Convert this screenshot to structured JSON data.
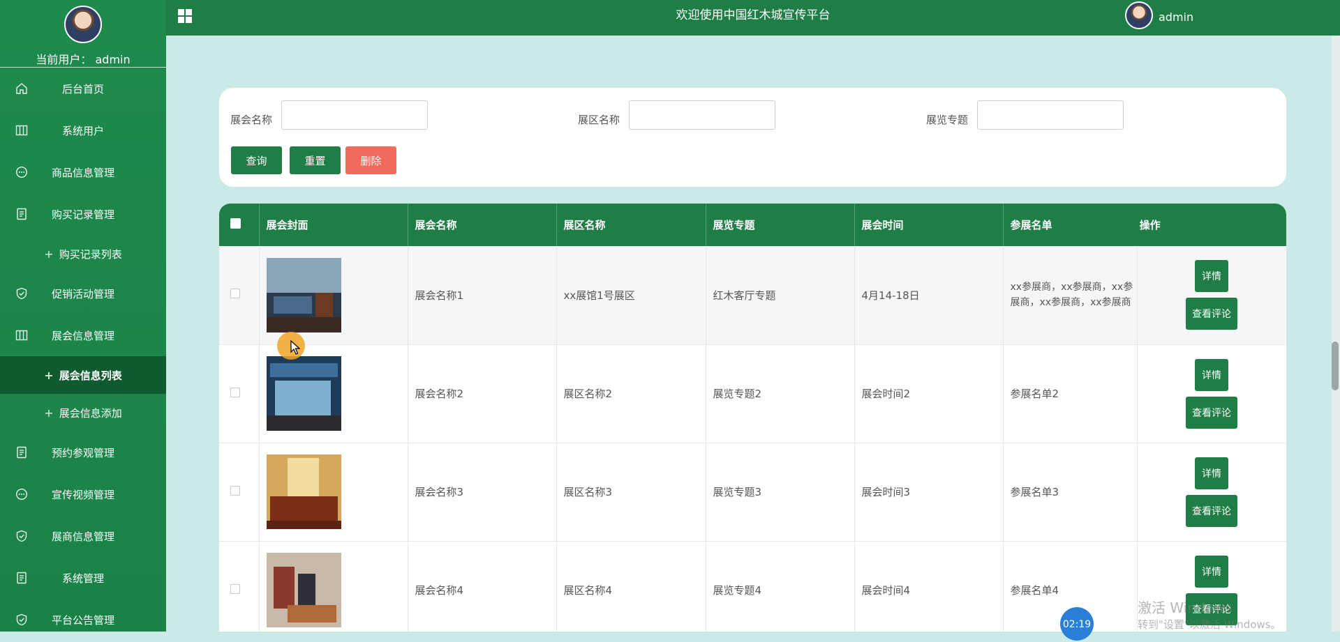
{
  "sidebar": {
    "user_label": "当前用户：",
    "username": "admin",
    "items": [
      {
        "label": "后台首页",
        "icon": "home-icon"
      },
      {
        "label": "系统用户",
        "icon": "columns-icon"
      },
      {
        "label": "商品信息管理",
        "icon": "chat-icon"
      },
      {
        "label": "购买记录管理",
        "icon": "document-icon",
        "children": [
          {
            "label": "购买记录列表"
          }
        ]
      },
      {
        "label": "促销活动管理",
        "icon": "shield-icon"
      },
      {
        "label": "展会信息管理",
        "icon": "columns-icon",
        "children": [
          {
            "label": "展会信息列表",
            "active": true
          },
          {
            "label": "展会信息添加"
          }
        ]
      },
      {
        "label": "预约参观管理",
        "icon": "document-icon"
      },
      {
        "label": "宣传视频管理",
        "icon": "chat-icon"
      },
      {
        "label": "展商信息管理",
        "icon": "shield-icon"
      },
      {
        "label": "系统管理",
        "icon": "document-icon"
      },
      {
        "label": "平台公告管理",
        "icon": "shield-icon"
      }
    ]
  },
  "header": {
    "title": "欢迎使用中国红木城宣传平台",
    "username": "admin"
  },
  "search": {
    "fields": [
      {
        "label": "展会名称",
        "value": ""
      },
      {
        "label": "展区名称",
        "value": ""
      },
      {
        "label": "展览专题",
        "value": ""
      }
    ],
    "query_label": "查询",
    "reset_label": "重置",
    "delete_label": "删除"
  },
  "table": {
    "columns": [
      "展会封面",
      "展会名称",
      "展区名称",
      "展览专题",
      "展会时间",
      "参展名单",
      "操作"
    ],
    "rows": [
      {
        "name": "展会名称1",
        "area": "xx展馆1号展区",
        "topic": "红木客厅专题",
        "time": "4月14-18日",
        "list_line1": "xx参展商，xx参展商，xx参",
        "list_line2": "展商，xx参展商，xx参展商"
      },
      {
        "name": "展会名称2",
        "area": "展区名称2",
        "topic": "展览专题2",
        "time": "展会时间2",
        "list_line1": "参展名单2",
        "list_line2": ""
      },
      {
        "name": "展会名称3",
        "area": "展区名称3",
        "topic": "展览专题3",
        "time": "展会时间3",
        "list_line1": "参展名单3",
        "list_line2": ""
      },
      {
        "name": "展会名称4",
        "area": "展区名称4",
        "topic": "展览专题4",
        "time": "展会时间4",
        "list_line1": "参展名单4",
        "list_line2": ""
      }
    ],
    "detail_label": "详情",
    "comment_label": "查看评论"
  },
  "overlay": {
    "timer": "02:19",
    "watermark_line1": "激活 Windows",
    "watermark_line2": "转到\"设置\"以激活 Windows。"
  },
  "colors": {
    "primary": "#1e7e45",
    "danger": "#f06a5e",
    "background": "#cbeae7"
  }
}
